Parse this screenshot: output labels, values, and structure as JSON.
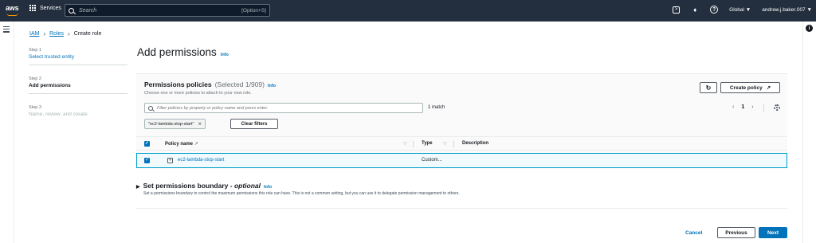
{
  "topbar": {
    "logo_text": "aws",
    "services_label": "Services",
    "search_placeholder": "Search",
    "search_shortcut": "[Option+S]",
    "region": "Global ▼",
    "account": "andrew.j.baker.007 ▼"
  },
  "breadcrumb": {
    "iam": "IAM",
    "roles": "Roles",
    "current": "Create role"
  },
  "steps": [
    {
      "label": "Step 1",
      "title": "Select trusted entity"
    },
    {
      "label": "Step 2",
      "title": "Add permissions"
    },
    {
      "label": "Step 3",
      "title": "Name, review, and create"
    }
  ],
  "page": {
    "title": "Add permissions",
    "info": "Info"
  },
  "policies": {
    "title": "Permissions policies",
    "selected": "(Selected 1/909)",
    "info": "Info",
    "subtitle": "Choose one or more policies to attach to your new role.",
    "create_label": "Create policy",
    "filter_placeholder": "Filter policies by property or policy name and press enter.",
    "match": "1 match",
    "page": "1",
    "token": "\"ec2-lambda-stop-start\"",
    "clear_label": "Clear filters",
    "columns": {
      "name": "Policy name",
      "type": "Type",
      "description": "Description"
    },
    "rows": [
      {
        "name": "ec2-lambda-stop-start",
        "type": "Custom...",
        "description": "",
        "checked": true
      }
    ]
  },
  "boundary": {
    "title_prefix": "Set permissions boundary - ",
    "title_optional": "optional",
    "info": "Info",
    "subtitle": "Set a permissions boundary to control the maximum permissions this role can have. This is not a common setting, but you can use it to delegate permission management to others."
  },
  "footer": {
    "cancel": "Cancel",
    "previous": "Previous",
    "next": "Next"
  },
  "colors": {
    "topbar": "#232f3e",
    "link": "#0073bb",
    "accent": "#ff9900",
    "selected_row": "#f1faff"
  }
}
